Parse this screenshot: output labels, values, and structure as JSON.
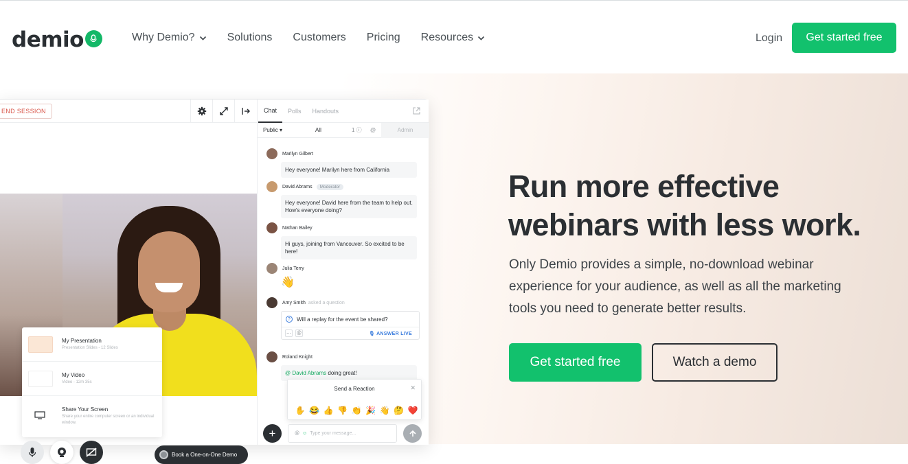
{
  "brand": {
    "name": "demio",
    "accent": "#12c16d"
  },
  "nav": {
    "items": [
      {
        "label": "Why Demio?",
        "has_dropdown": true
      },
      {
        "label": "Solutions",
        "has_dropdown": false
      },
      {
        "label": "Customers",
        "has_dropdown": false
      },
      {
        "label": "Pricing",
        "has_dropdown": false
      },
      {
        "label": "Resources",
        "has_dropdown": true
      }
    ],
    "login": "Login",
    "cta": "Get started free"
  },
  "hero": {
    "headline": "Run more effective webinars with less work.",
    "subtext": "Only Demio provides a simple, no-download webinar experience for your audience, as well as all the marketing tools you need to generate better results.",
    "primary_cta": "Get started free",
    "secondary_cta": "Watch a demo"
  },
  "mock": {
    "end_session": "END SESSION",
    "toolbar_icons": [
      "gear-icon",
      "expand-icon",
      "exit-icon"
    ],
    "media": [
      {
        "title": "My Presentation",
        "subtitle": "Presentation Slides - 12 Slides"
      },
      {
        "title": "My Video",
        "subtitle": "Video - 12m 35s"
      },
      {
        "title": "Share Your Screen",
        "subtitle": "Share your entire computer screen or an individual window."
      }
    ],
    "book_demo": "Book a One-on-One Demo",
    "chat": {
      "tabs": [
        "Chat",
        "Polls",
        "Handouts"
      ],
      "filter": {
        "public": "Public",
        "all": "All",
        "questions": "1",
        "admin": "Admin"
      },
      "messages": [
        {
          "name": "Marilyn Gilbert",
          "text": "Hey everyone! Marilyn here from California"
        },
        {
          "name": "David Abrams",
          "badge": "Moderator",
          "text": "Hey everyone! David here from the team to help out. How's everyone doing?"
        },
        {
          "name": "Nathan Bailey",
          "text": "Hi guys, joining from Vancouver. So excited to be here!"
        },
        {
          "name": "Julia Terry",
          "text": "👋"
        },
        {
          "name": "Amy Smith",
          "note": "asked a question",
          "question": "Will a replay for the event be shared?",
          "answer_label": "ANSWER LIVE"
        },
        {
          "name": "Roland Knight",
          "mention": "@ David Abrams",
          "text": " doing great!"
        }
      ],
      "reaction_title": "Send a Reaction",
      "reactions": [
        "✋",
        "😂",
        "👍",
        "👎",
        "👏",
        "🎉",
        "👋",
        "🤔",
        "❤️"
      ],
      "input_placeholder": "Type your message..."
    }
  }
}
